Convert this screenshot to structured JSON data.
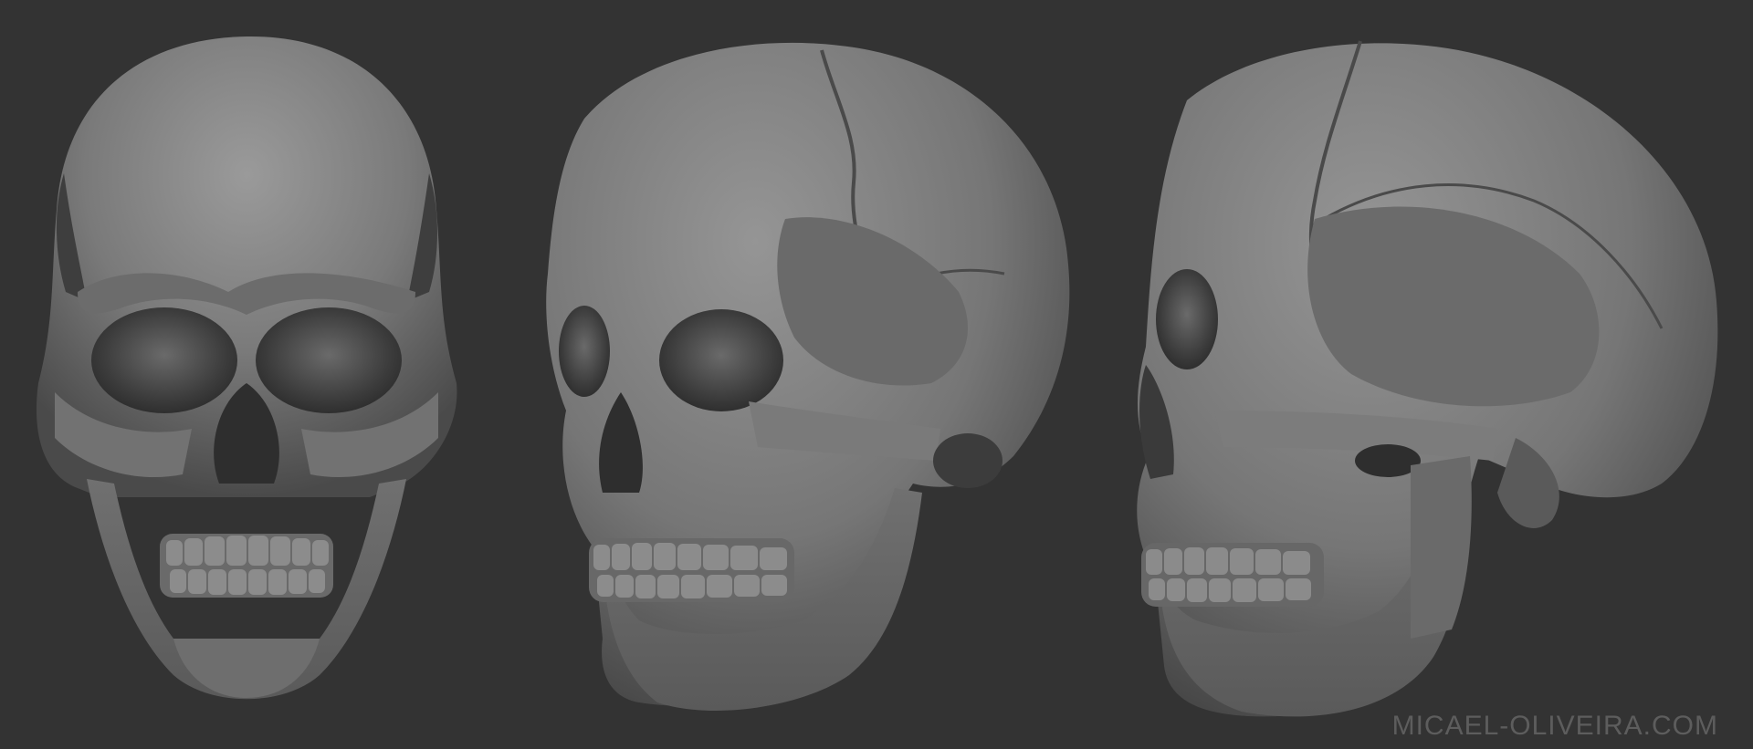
{
  "background_color": "#333333",
  "skull_color": "#8a8a8a",
  "views": [
    {
      "id": "front",
      "icon": "skull-front-view"
    },
    {
      "id": "three-quarter",
      "icon": "skull-three-quarter-view"
    },
    {
      "id": "profile",
      "icon": "skull-side-view"
    }
  ],
  "watermark": {
    "text": "MICAEL-OLIVEIRA.COM",
    "color": "#5d5d5d"
  }
}
